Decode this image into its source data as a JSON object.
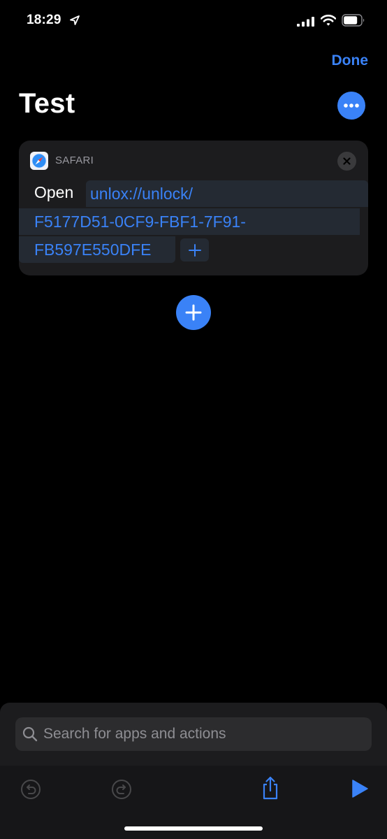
{
  "status_bar": {
    "time": "18:29"
  },
  "header": {
    "done_label": "Done",
    "title": "Test"
  },
  "action": {
    "app_label": "SAFARI",
    "verb": "Open",
    "url_lines": [
      "unlox://unlock/",
      "F5177D51-0CF9-FBF1-7F91-",
      "FB597E550DFE"
    ]
  },
  "search": {
    "placeholder": "Search for apps and actions",
    "value": ""
  },
  "icons": {
    "location": "location-arrow-icon",
    "signal": "cellular-signal-icon",
    "wifi": "wifi-icon",
    "battery": "battery-icon",
    "more": "ellipsis-icon",
    "safari": "safari-compass-icon",
    "remove": "close-icon",
    "add_variable": "plus-icon",
    "add_action": "plus-icon",
    "search": "search-icon",
    "undo": "undo-icon",
    "redo": "redo-icon",
    "share": "share-icon",
    "play": "play-icon"
  },
  "colors": {
    "accent": "#3a82f7",
    "background": "#000000",
    "card": "#1c1c1e",
    "token": "#242a33",
    "muted": "#98989f",
    "disabled": "#48484a"
  }
}
